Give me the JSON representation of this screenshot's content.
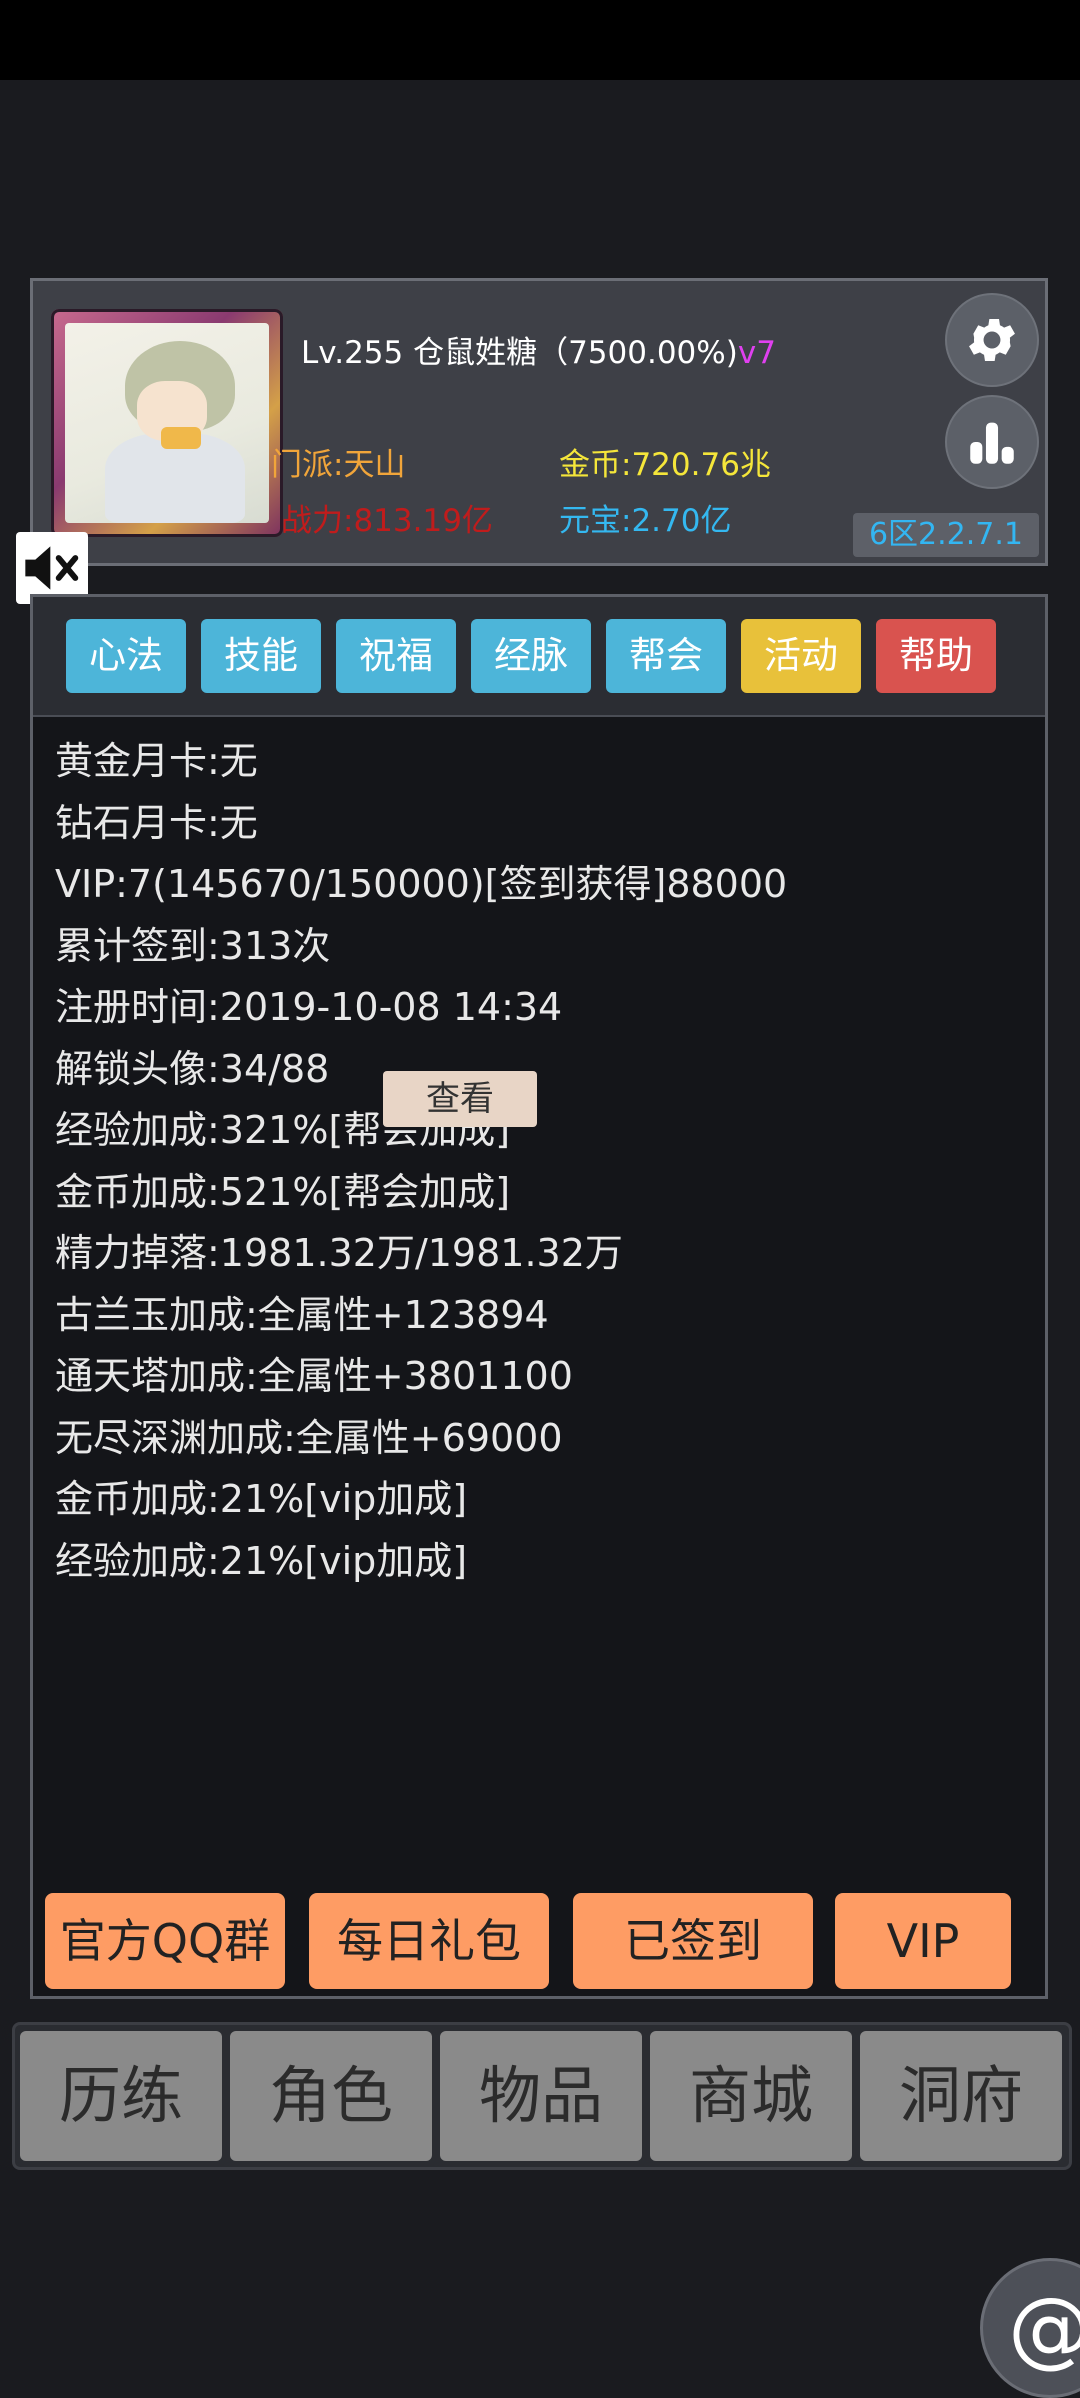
{
  "profile": {
    "level_text": "Lv.255 仓鼠姓糖（7500.00%)",
    "vip_tag": "v7",
    "sect": "门派:天山",
    "power": "战力:813.19亿",
    "gold": "金币:720.76兆",
    "ingot": "元宝:2.70亿",
    "server": "6区2.2.7.1"
  },
  "tabs": [
    "心法",
    "技能",
    "祝福",
    "经脉",
    "帮会",
    "活动",
    "帮助"
  ],
  "info_lines": [
    "黄金月卡:无",
    "钻石月卡:无",
    "VIP:7(145670/150000)[签到获得]88000",
    "累计签到:313次",
    "注册时间:2019-10-08 14:34",
    "解锁头像:34/88",
    "经验加成:321%[帮会加成]",
    "金币加成:521%[帮会加成]",
    "精力掉落:1981.32万/1981.32万",
    "古兰玉加成:全属性+123894",
    "通天塔加成:全属性+3801100",
    "无尽深渊加成:全属性+69000",
    "金币加成:21%[vip加成]",
    "经验加成:21%[vip加成]"
  ],
  "view_button": "查看",
  "bottom_buttons": [
    "官方QQ群",
    "每日礼包",
    "已签到",
    "VIP"
  ],
  "nav": [
    "历练",
    "角色",
    "物品",
    "商城",
    "洞府"
  ],
  "at_symbol": "@",
  "colors": {
    "tab_blue": "#4db5d9",
    "tab_yellow": "#e8c13a",
    "tab_red": "#d9534f",
    "orange_button": "#fe9c64",
    "gold_text": "#f5e63a",
    "ingot_text": "#34b8f0",
    "power_text": "#c01c1c",
    "sect_text": "#f1a53a",
    "vip_tag": "#e040f0"
  }
}
